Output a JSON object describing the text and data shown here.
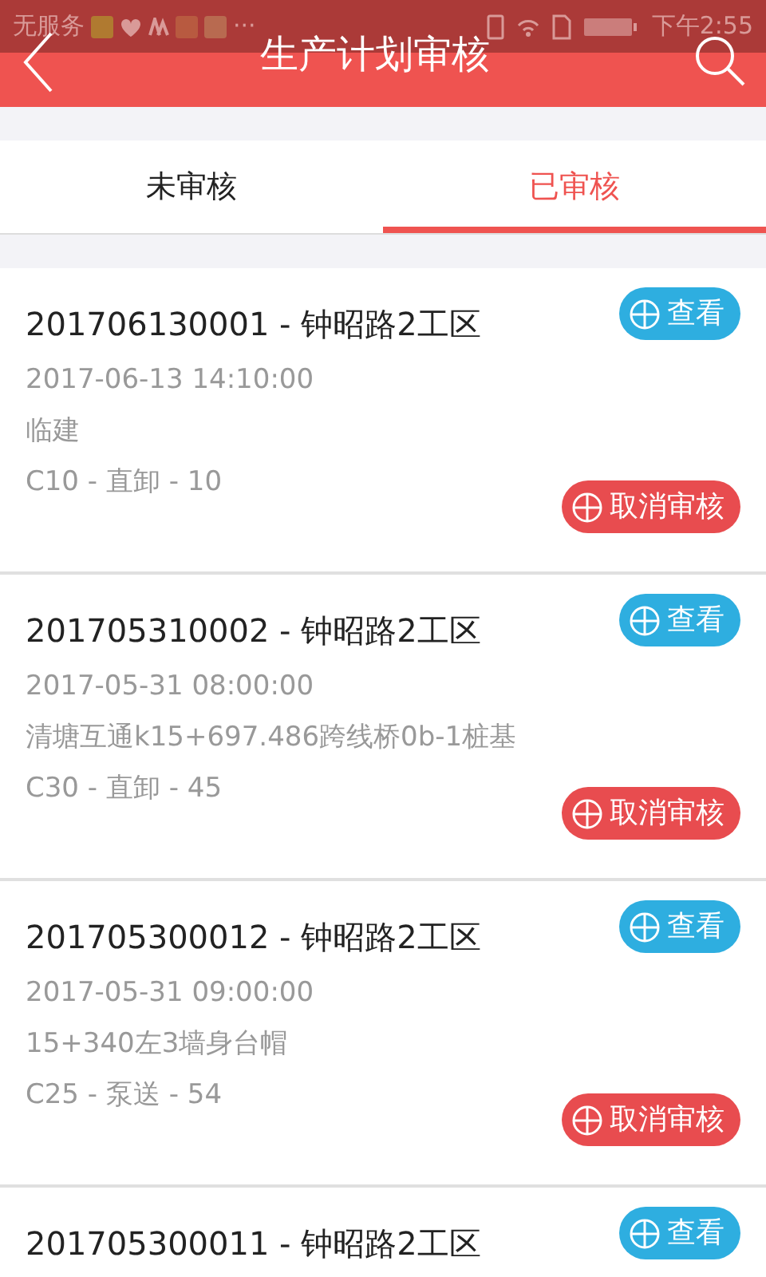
{
  "status_bar": {
    "carrier": "无服务",
    "more": "···",
    "time": "下午2:55"
  },
  "header": {
    "title": "生产计划审核"
  },
  "tabs": [
    {
      "label": "未审核",
      "selected": false
    },
    {
      "label": "已审核",
      "selected": true
    }
  ],
  "records": [
    {
      "title": "201706130001 - 钟昭路2工区",
      "date": "2017-06-13 14:10:00",
      "location": "临建",
      "spec": "C10 - 直卸 - 10",
      "view_button": "查看",
      "cancel_button": "取消审核"
    },
    {
      "title": "201705310002 - 钟昭路2工区",
      "date": "2017-05-31 08:00:00",
      "location": "清塘互通k15+697.486跨线桥0b-1桩基",
      "spec": "C30 - 直卸 - 45",
      "view_button": "查看",
      "cancel_button": "取消审核"
    },
    {
      "title": "201705300012 - 钟昭路2工区",
      "date": "2017-05-31 09:00:00",
      "location": "15+340左3墙身台帽",
      "spec": "C25 - 泵送 - 54",
      "view_button": "查看",
      "cancel_button": "取消审核"
    },
    {
      "title": "201705300011 - 钟昭路2工区",
      "view_button": "查看"
    }
  ]
}
